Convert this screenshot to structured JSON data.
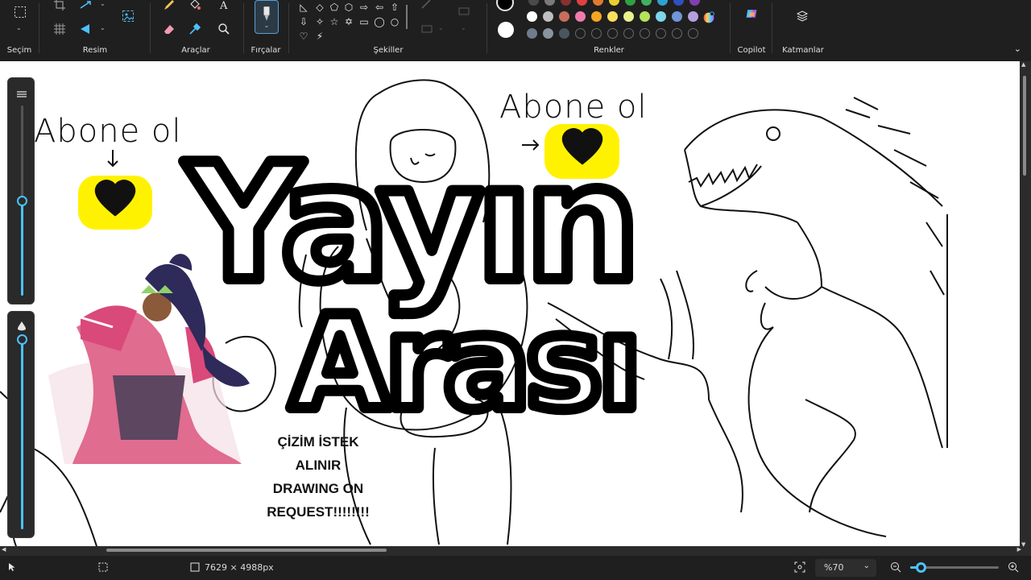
{
  "ribbon": {
    "groups": {
      "selection": "Seçim",
      "image": "Resim",
      "tools": "Araçlar",
      "brushes": "Fırçalar",
      "shapes": "Şekiller",
      "colors": "Renkler",
      "copilot": "Copilot",
      "layers": "Katmanlar"
    },
    "palette_row1": [
      "#ffffff",
      "#bfbfbf",
      "#c86e5a",
      "#ef7bac",
      "#f5a623",
      "#f8e05c",
      "#e8f28c",
      "#b5e25a",
      "#7fd5e9",
      "#7196d6",
      "#b4a0e0"
    ],
    "palette_row2_filled": [
      "#6e7c8c",
      "#8a93a0",
      "#4a5560"
    ],
    "primary_color": "#000000",
    "secondary_color": "#ffffff"
  },
  "canvas": {
    "abone_left": "Abone ol",
    "abone_right": "Abone ol",
    "title_line1": "Yayın",
    "title_line2": "Arası",
    "request_lines": [
      "ÇİZİM İSTEK",
      "ALINIR",
      "DRAWING ON",
      "REQUEST!!!!!!!!"
    ]
  },
  "status": {
    "dimensions": "7629 × 4988px",
    "zoom": "%70",
    "zoom_fraction": 0.12
  },
  "sliders": {
    "size_level": 0.5,
    "opacity_level": 1.0
  }
}
